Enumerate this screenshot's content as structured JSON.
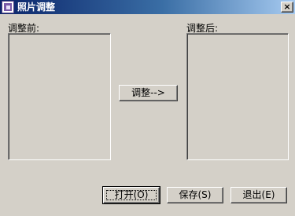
{
  "window": {
    "title": "照片调整",
    "close_glyph": "×",
    "icon": "photo-app-icon"
  },
  "labels": {
    "before": "调整前:",
    "after": "调整后:"
  },
  "buttons": {
    "adjust": "调整-->",
    "open": "打开(O)",
    "save": "保存(S)",
    "exit": "退出(E)"
  },
  "colors": {
    "face": "#d4d0c8",
    "title_start": "#0a246a",
    "title_end": "#a6caf0"
  }
}
